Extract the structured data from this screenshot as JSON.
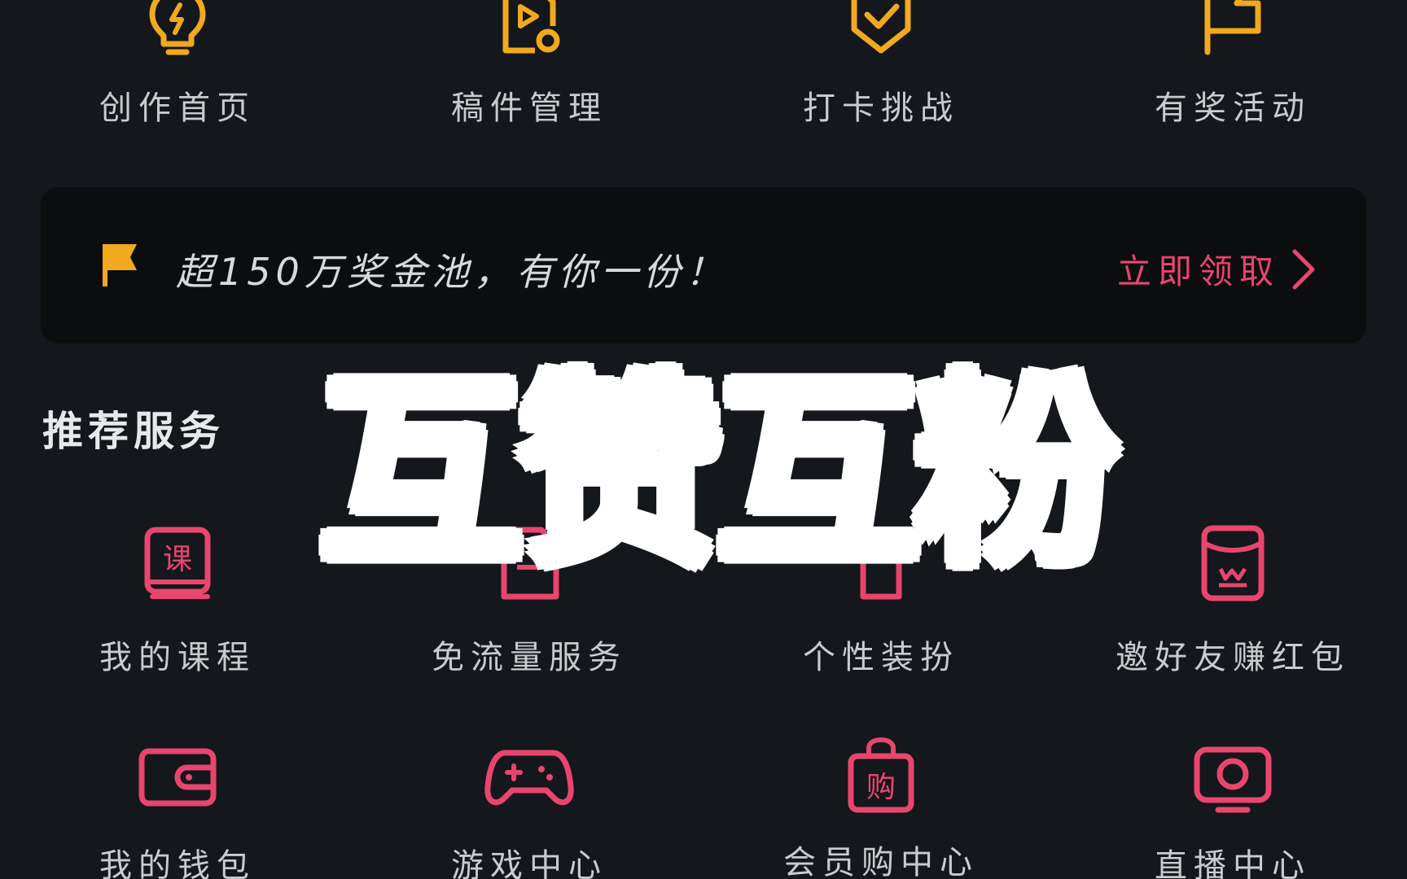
{
  "creator_tools": [
    {
      "label": "创作首页",
      "icon": "lightbulb-icon"
    },
    {
      "label": "稿件管理",
      "icon": "video-file-icon"
    },
    {
      "label": "打卡挑战",
      "icon": "shield-check-icon"
    },
    {
      "label": "有奖活动",
      "icon": "flag-icon"
    }
  ],
  "banner": {
    "text": "超150万奖金池，有你一份！",
    "action": "立即领取",
    "icon": "flag-icon"
  },
  "section": {
    "title": "推荐服务"
  },
  "services": [
    {
      "label": "我的课程",
      "icon": "course-book-icon",
      "badge": "课"
    },
    {
      "label": "免流量服务",
      "icon": "sim-card-icon"
    },
    {
      "label": "个性装扮",
      "icon": "shirt-icon"
    },
    {
      "label": "邀好友赚红包",
      "icon": "red-envelope-icon"
    },
    {
      "label": "我的钱包",
      "icon": "wallet-icon"
    },
    {
      "label": "游戏中心",
      "icon": "gamepad-icon"
    },
    {
      "label": "会员购中心",
      "icon": "shopping-bag-icon",
      "badge": "购"
    },
    {
      "label": "直播中心",
      "icon": "live-tv-icon"
    }
  ],
  "overlay": {
    "title": "互赞互粉"
  },
  "colors": {
    "background": "#14171b",
    "banner_bg": "#0b0d0f",
    "creator_icon": "#f2a91e",
    "service_icon": "#e8456f",
    "label_text": "#c9cbce",
    "accent_pink": "#e8456f"
  }
}
